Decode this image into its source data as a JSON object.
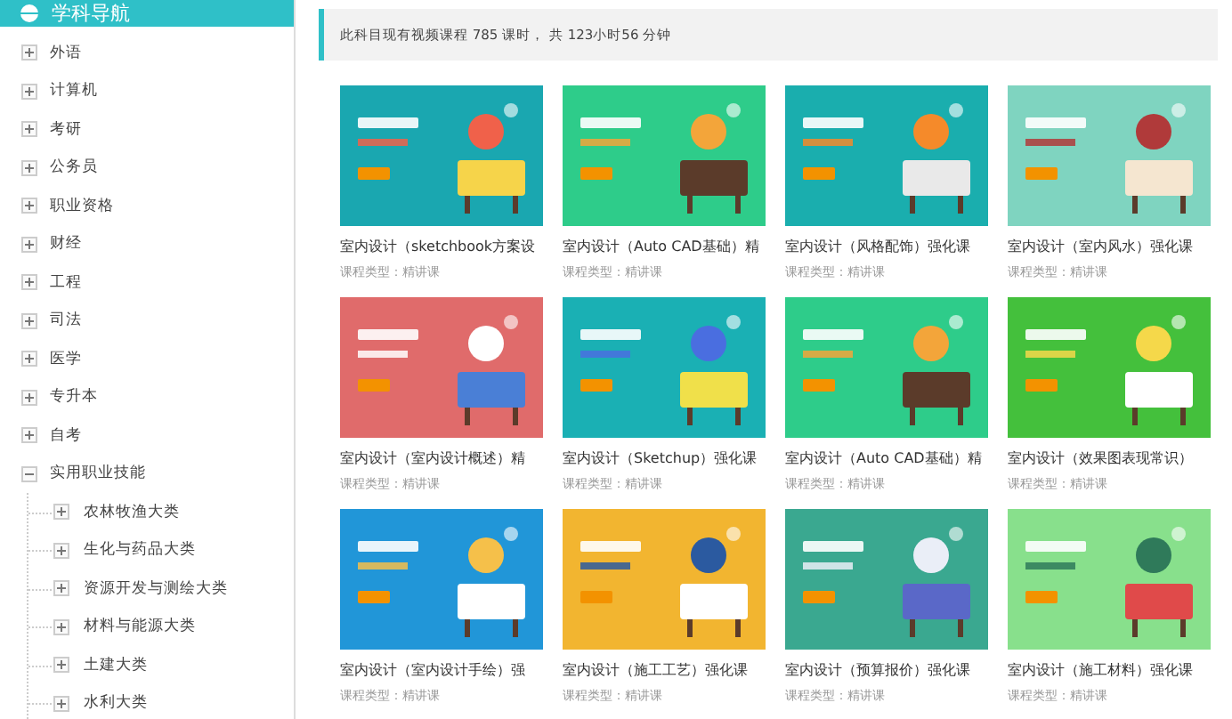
{
  "sidebar": {
    "title": "学科导航",
    "items": [
      {
        "label": "外语",
        "expanded": false
      },
      {
        "label": "计算机",
        "expanded": false
      },
      {
        "label": "考研",
        "expanded": false
      },
      {
        "label": "公务员",
        "expanded": false
      },
      {
        "label": "职业资格",
        "expanded": false
      },
      {
        "label": "财经",
        "expanded": false
      },
      {
        "label": "工程",
        "expanded": false
      },
      {
        "label": "司法",
        "expanded": false
      },
      {
        "label": "医学",
        "expanded": false
      },
      {
        "label": "专升本",
        "expanded": false
      },
      {
        "label": "自考",
        "expanded": false
      },
      {
        "label": "实用职业技能",
        "expanded": true,
        "children": [
          {
            "label": "农林牧渔大类",
            "expanded": false
          },
          {
            "label": "生化与药品大类",
            "expanded": false
          },
          {
            "label": "资源开发与测绘大类",
            "expanded": false
          },
          {
            "label": "材料与能源大类",
            "expanded": false
          },
          {
            "label": "土建大类",
            "expanded": false
          },
          {
            "label": "水利大类",
            "expanded": false
          }
        ]
      }
    ]
  },
  "notice": "此科目现有视频课程 785 课时， 共 123小时56 分钟",
  "courses": [
    {
      "kind": "picture",
      "title": "室内设计（sketchbook方案设",
      "type": "课程类型：精讲课"
    },
    {
      "kind": "picture",
      "title": "室内设计（Auto CAD基础）精",
      "type": "课程类型：精讲课"
    },
    {
      "kind": "picture",
      "title": "室内设计（风格配饰）强化课",
      "type": "课程类型：精讲课"
    },
    {
      "kind": "picture",
      "title": "室内设计（室内风水）强化课",
      "type": "课程类型：精讲课"
    },
    {
      "kind": "picture",
      "title": "室内设计（室内设计概述）精",
      "type": "课程类型：精讲课"
    },
    {
      "kind": "picture",
      "title": "室内设计（Sketchup）强化课",
      "type": "课程类型：精讲课"
    },
    {
      "kind": "picture",
      "title": "室内设计（Auto CAD基础）精",
      "type": "课程类型：精讲课"
    },
    {
      "kind": "picture",
      "title": "室内设计（效果图表现常识）",
      "type": "课程类型：精讲课"
    },
    {
      "kind": "picture",
      "title": "室内设计（室内设计手绘）强",
      "type": "课程类型：精讲课"
    },
    {
      "kind": "picture",
      "title": "室内设计（施工工艺）强化课",
      "type": "课程类型：精讲课"
    },
    {
      "kind": "picture",
      "title": "室内设计（预算报价）强化课",
      "type": "课程类型：精讲课"
    },
    {
      "kind": "picture",
      "title": "室内设计（施工材料）强化课",
      "type": "课程类型：精讲课"
    }
  ]
}
